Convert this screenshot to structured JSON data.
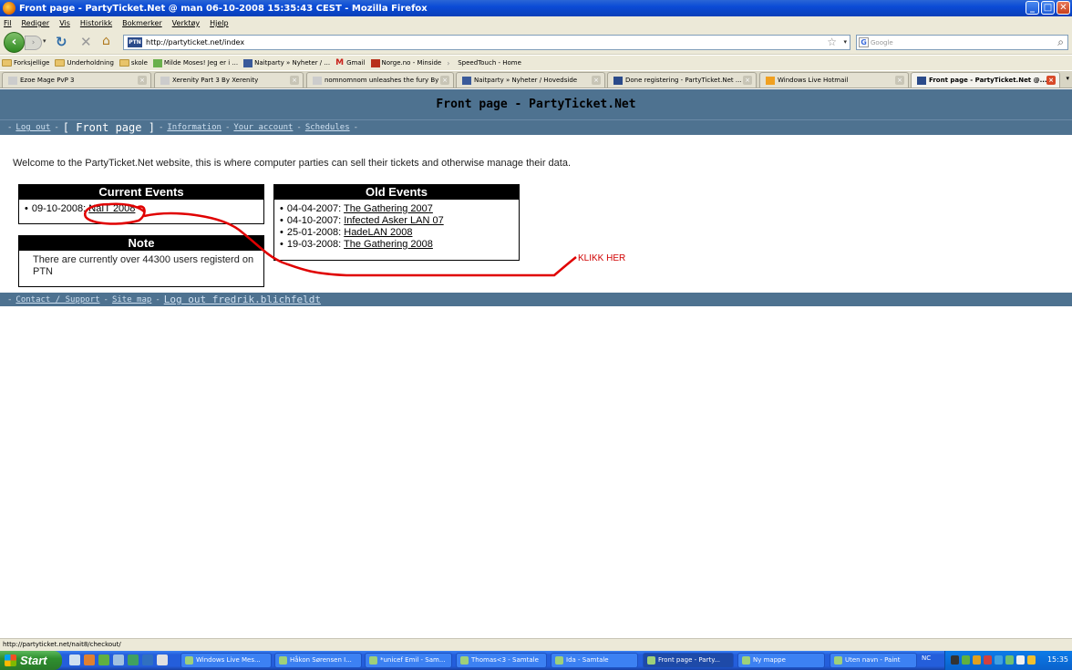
{
  "window": {
    "title": "Front page - PartyTicket.Net @ man 06-10-2008 15:35:43 CEST - Mozilla Firefox"
  },
  "menu": [
    "Fil",
    "Rediger",
    "Vis",
    "Historikk",
    "Bokmerker",
    "Verktøy",
    "Hjelp"
  ],
  "nav": {
    "url": "http://partyticket.net/index",
    "search_placeholder": "Google",
    "site_icon_label": "PTN"
  },
  "bookmarks": [
    {
      "label": "Forksjellige",
      "icon": "folder-icon"
    },
    {
      "label": "Underholdning",
      "icon": "folder-icon"
    },
    {
      "label": "skole",
      "icon": "folder-icon"
    },
    {
      "label": "Milde Moses! Jeg er i ...",
      "icon": "page-icon"
    },
    {
      "label": "Naitparty » Nyheter / ...",
      "icon": "naitparty-icon"
    },
    {
      "label": "Gmail",
      "icon": "gmail-icon"
    },
    {
      "label": "Norge.no - Minside",
      "icon": "norge-icon"
    },
    {
      "label": "SpeedTouch - Home",
      "icon": "page-icon"
    }
  ],
  "tabs": [
    {
      "label": "Ezoe Mage PvP 3"
    },
    {
      "label": "Xerenity Part 3 By Xerenity"
    },
    {
      "label": "nomnomnom unleashes the fury By ..."
    },
    {
      "label": "Naitparty » Nyheter / Hovedside"
    },
    {
      "label": "Done registering - PartyTicket.Net ..."
    },
    {
      "label": "Windows Live Hotmail"
    },
    {
      "label": "Front page - PartyTicket.Net @..."
    }
  ],
  "page": {
    "header": "Front page - PartyTicket.Net",
    "nav_links": {
      "logout": "Log out",
      "current": "[ Front page ]",
      "information": "Information",
      "account": "Your account",
      "schedules": "Schedules"
    },
    "welcome": "Welcome to the PartyTicket.Net website, this is where computer parties can sell their tickets and otherwise manage their data.",
    "current_events": {
      "title": "Current Events",
      "items": [
        {
          "date": "09-10-2008:",
          "name": "NaIT 2008"
        }
      ]
    },
    "note": {
      "title": "Note",
      "text": "There are currently over 44300 users registerd on PTN"
    },
    "old_events": {
      "title": "Old Events",
      "items": [
        {
          "date": "04-04-2007:",
          "name": "The Gathering 2007"
        },
        {
          "date": "04-10-2007:",
          "name": "Infected Asker LAN 07"
        },
        {
          "date": "25-01-2008:",
          "name": "HadeLAN 2008"
        },
        {
          "date": "19-03-2008:",
          "name": "The Gathering 2008"
        }
      ]
    },
    "footer": {
      "contact": "Contact / Support",
      "sitemap": "Site map",
      "user": "Log out fredrik.blichfeldt"
    },
    "annotation": "KLIKK HER",
    "annotation_color": "#d00000"
  },
  "status": "http://partyticket.net/nait8/checkout/",
  "taskbar": {
    "start": "Start",
    "tasks": [
      {
        "label": "Windows Live Mes..."
      },
      {
        "label": "Håkon Sørensen I..."
      },
      {
        "label": "*unicef Emil - Sam..."
      },
      {
        "label": "Thomas<3 - Samtale"
      },
      {
        "label": "Ida - Samtale"
      },
      {
        "label": "Front page - Party..."
      },
      {
        "label": "Ny mappe"
      },
      {
        "label": "Uten navn - Paint"
      }
    ],
    "lang": "NC",
    "clock": "15:35"
  },
  "colors": {
    "page_header_bg": "#4e7290",
    "titlebar": "#0b4bd6",
    "annotation": "#d00000"
  }
}
